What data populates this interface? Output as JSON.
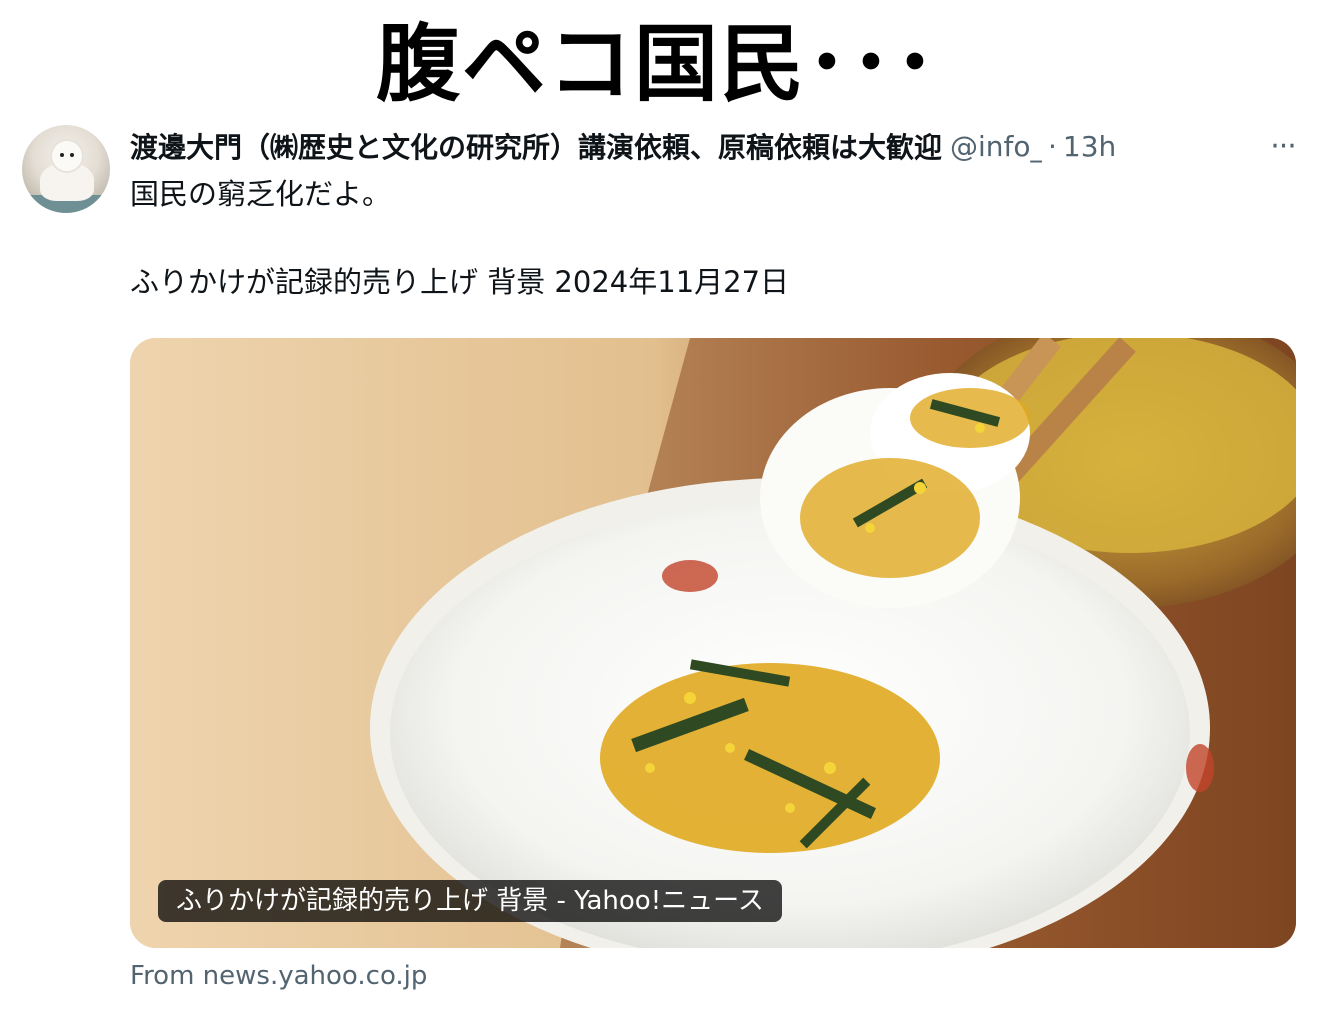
{
  "meme_caption": "腹ペコ国民･･･",
  "tweet": {
    "display_name": "渡邊大門（㈱歴史と文化の研究所）講演依頼、原稿依頼は大歓迎",
    "handle": "@info_",
    "separator": "·",
    "time": "13h",
    "more_icon": "···",
    "text_line1": "国民の窮乏化だよ。",
    "text_line2": "ふりかけが記録的売り上げ 背景 2024年11月27日",
    "card": {
      "image_subject": "rice-bowl-with-furikake",
      "label": "ふりかけが記録的売り上げ 背景 - Yahoo!ニュース"
    },
    "source": "From news.yahoo.co.jp"
  },
  "colors": {
    "text_primary": "#0f1419",
    "text_secondary": "#536471",
    "card_label_bg": "#000000"
  }
}
